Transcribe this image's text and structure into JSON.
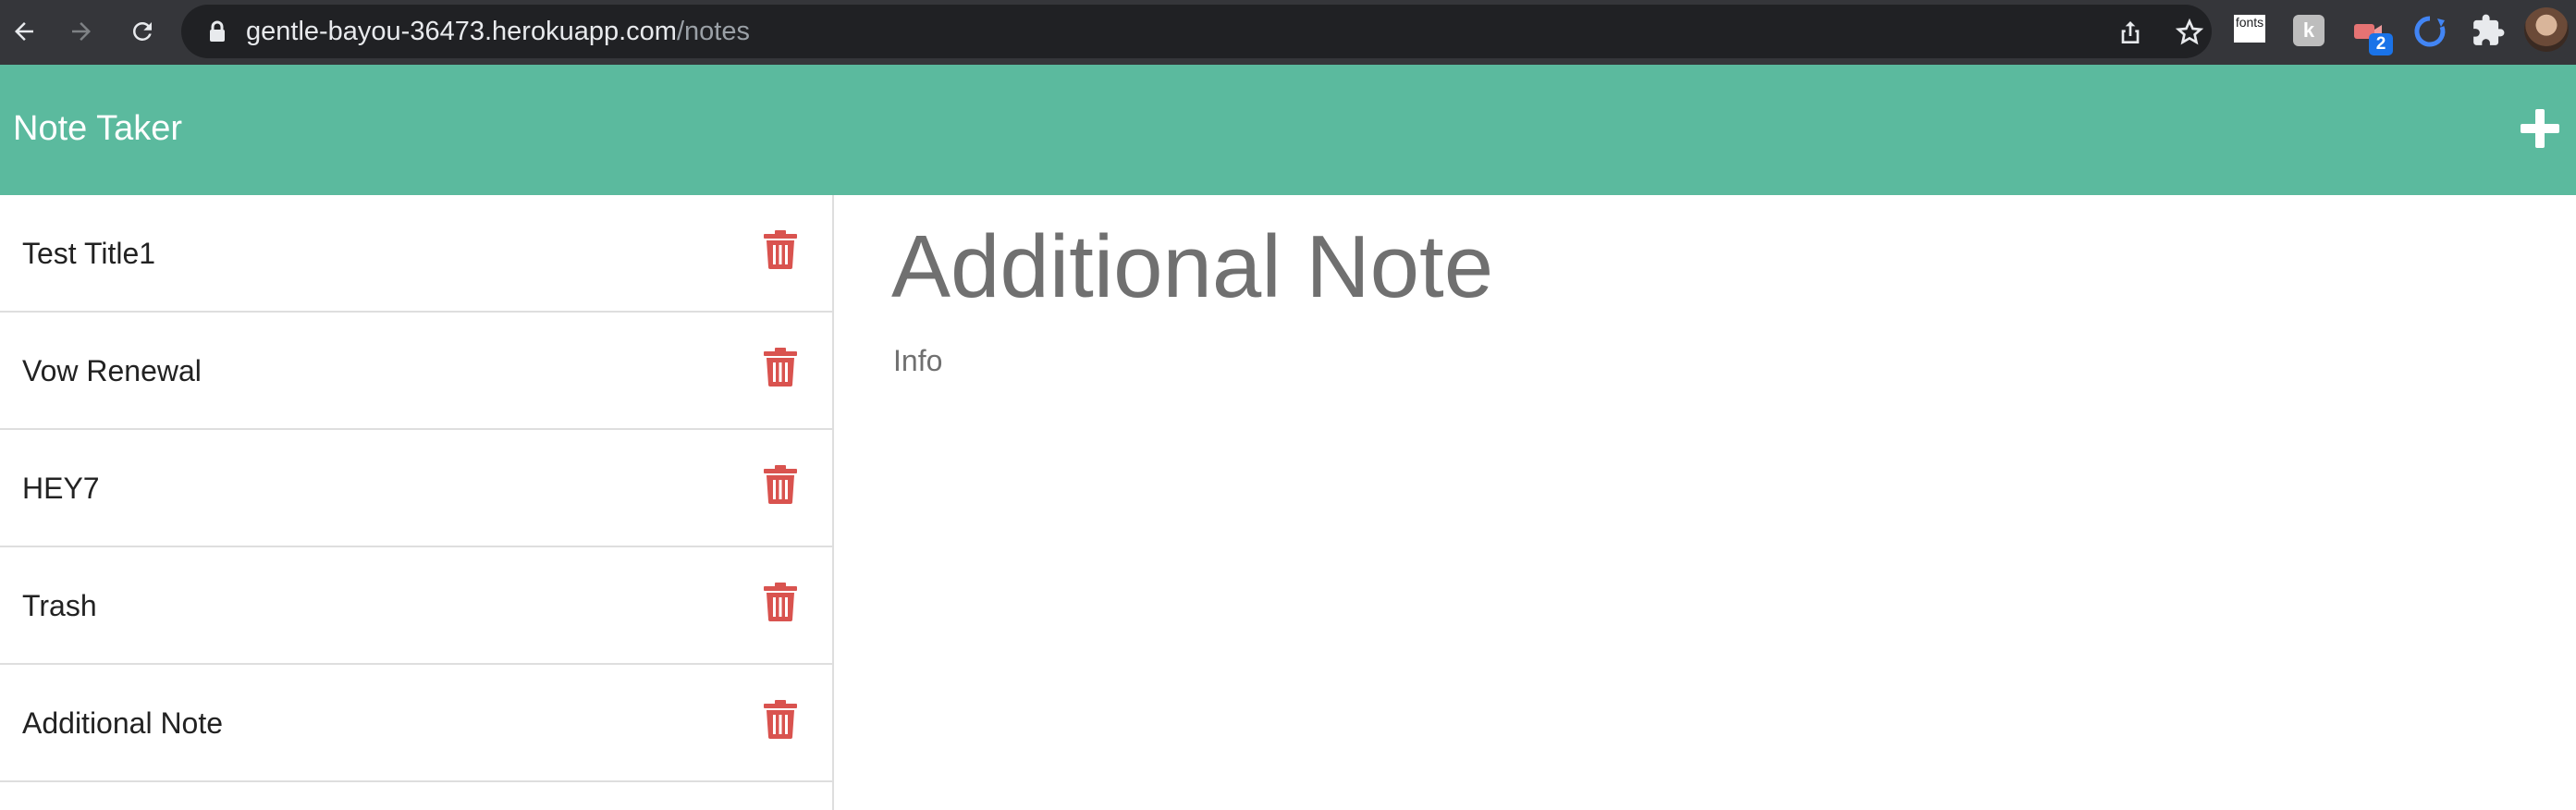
{
  "browser": {
    "url_host": "gentle-bayou-36473.herokuapp.com",
    "url_path": "/notes",
    "extension_fonts_label": "fonts",
    "extension_k_label": "k",
    "extension_badge": "2"
  },
  "app": {
    "title": "Note Taker",
    "accent_color": "#5bba9e",
    "delete_color": "#d9534f"
  },
  "notes": [
    {
      "title": "Test Title1"
    },
    {
      "title": "Vow Renewal"
    },
    {
      "title": "HEY7"
    },
    {
      "title": "Trash"
    },
    {
      "title": "Additional Note"
    }
  ],
  "active_note": {
    "title": "Additional Note",
    "text": "Info"
  },
  "icons": {
    "back": "arrow-left-icon",
    "forward": "arrow-right-icon",
    "reload": "reload-icon",
    "lock": "lock-icon",
    "share": "share-icon",
    "bookmark": "star-icon",
    "extensions": "puzzle-icon",
    "new_note": "plus-icon",
    "delete": "trash-icon"
  }
}
